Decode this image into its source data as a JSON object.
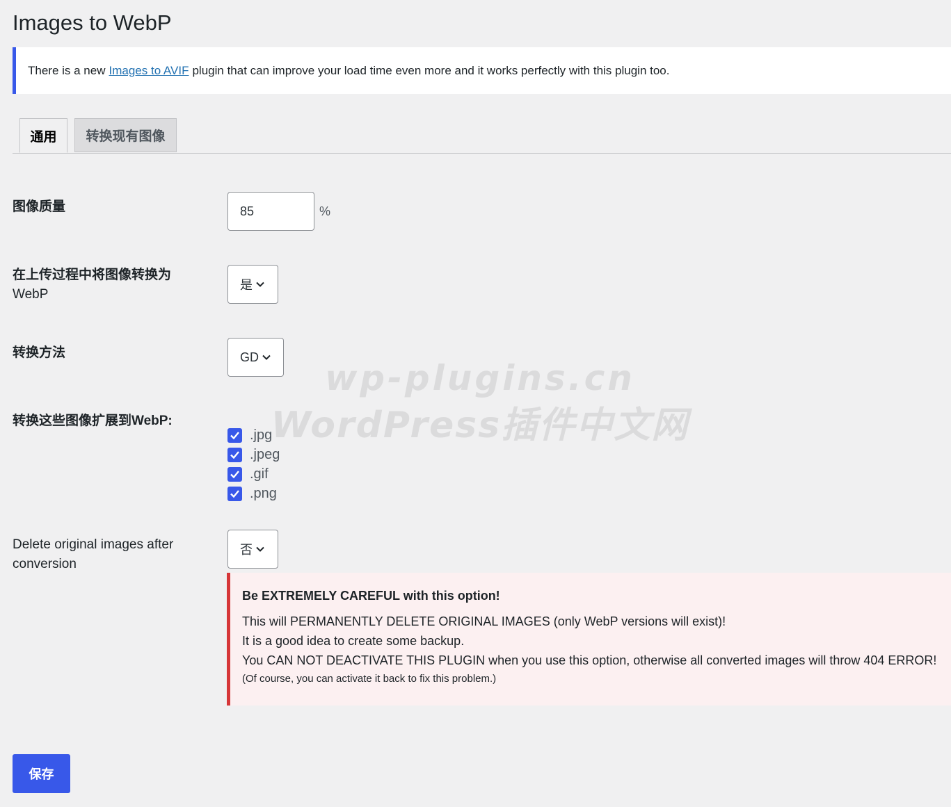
{
  "page": {
    "title": "Images to WebP"
  },
  "notice": {
    "text_before": "There is a new",
    "link_text": "Images to AVIF",
    "text_after": "plugin that can improve your load time even more and it works perfectly with this plugin too."
  },
  "tabs": [
    {
      "label": "通用",
      "active": true
    },
    {
      "label": "转换现有图像",
      "active": false
    }
  ],
  "settings": {
    "quality": {
      "label": "图像质量",
      "value": "85",
      "unit": "%"
    },
    "convert_on_upload": {
      "label_line1": "在上传过程中将图像转换为",
      "label_line2": "WebP",
      "selected": "是"
    },
    "method": {
      "label": "转换方法",
      "selected": "GD"
    },
    "extensions": {
      "label": "转换这些图像扩展到WebP:",
      "items": [
        {
          "label": ".jpg",
          "checked": true
        },
        {
          "label": ".jpeg",
          "checked": true
        },
        {
          "label": ".gif",
          "checked": true
        },
        {
          "label": ".png",
          "checked": true
        }
      ]
    },
    "delete_originals": {
      "label_line1": "Delete original images after",
      "label_line2": "conversion",
      "selected": "否"
    }
  },
  "warning": {
    "title": "Be EXTREMELY CAREFUL with this option!",
    "line1": "This will PERMANENTLY DELETE ORIGINAL IMAGES (only WebP versions will exist)!",
    "line2": "It is a good idea to create some backup.",
    "line3": "You CAN NOT DEACTIVATE THIS PLUGIN when you use this option, otherwise all converted images will throw 404 ERROR!",
    "note": "(Of course, you can activate it back to fix this problem.)"
  },
  "save_button": {
    "label": "保存"
  },
  "watermark": {
    "line1": "wp-plugins.cn",
    "line2": "WordPress插件中文网"
  },
  "colors": {
    "accent": "#3858e9",
    "danger": "#d63638",
    "background": "#f0f0f1"
  }
}
